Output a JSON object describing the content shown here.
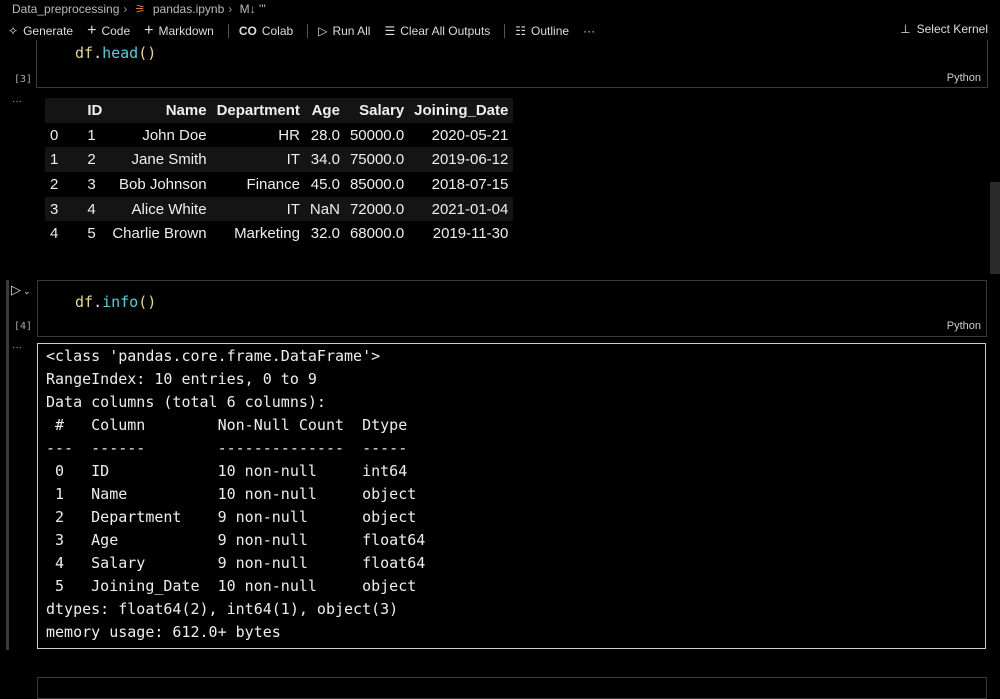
{
  "breadcrumb": [
    "Data_preprocessing",
    "pandas.ipynb",
    "M↓ '''"
  ],
  "toolbar": {
    "generate": "Generate",
    "code": "Code",
    "markdown": "Markdown",
    "colab": "Colab",
    "run_all": "Run All",
    "clear_all": "Clear All Outputs",
    "outline": "Outline",
    "more": "···",
    "select_kernel": "Select Kernel"
  },
  "cells": [
    {
      "exec": "[3]",
      "code_obj": "df",
      "code_dot": ".",
      "code_fn": "head",
      "code_paren": "()",
      "lang": "Python",
      "more": "···"
    },
    {
      "exec": "[4]",
      "code_obj": "df",
      "code_dot": ".",
      "code_fn": "info",
      "code_paren": "()",
      "lang": "Python",
      "more": "···"
    }
  ],
  "table": {
    "columns": [
      "",
      "ID",
      "Name",
      "Department",
      "Age",
      "Salary",
      "Joining_Date"
    ],
    "rows": [
      [
        "0",
        "1",
        "John Doe",
        "HR",
        "28.0",
        "50000.0",
        "2020-05-21"
      ],
      [
        "1",
        "2",
        "Jane Smith",
        "IT",
        "34.0",
        "75000.0",
        "2019-06-12"
      ],
      [
        "2",
        "3",
        "Bob Johnson",
        "Finance",
        "45.0",
        "85000.0",
        "2018-07-15"
      ],
      [
        "3",
        "4",
        "Alice White",
        "IT",
        "NaN",
        "72000.0",
        "2021-01-04"
      ],
      [
        "4",
        "5",
        "Charlie Brown",
        "Marketing",
        "32.0",
        "68000.0",
        "2019-11-30"
      ]
    ]
  },
  "info_output": "<class 'pandas.core.frame.DataFrame'>\nRangeIndex: 10 entries, 0 to 9\nData columns (total 6 columns):\n #   Column        Non-Null Count  Dtype  \n---  ------        --------------  -----  \n 0   ID            10 non-null     int64  \n 1   Name          10 non-null     object \n 2   Department    9 non-null      object \n 3   Age           9 non-null      float64\n 4   Salary        9 non-null      float64\n 5   Joining_Date  10 non-null     object \ndtypes: float64(2), int64(1), object(3)\nmemory usage: 612.0+ bytes"
}
